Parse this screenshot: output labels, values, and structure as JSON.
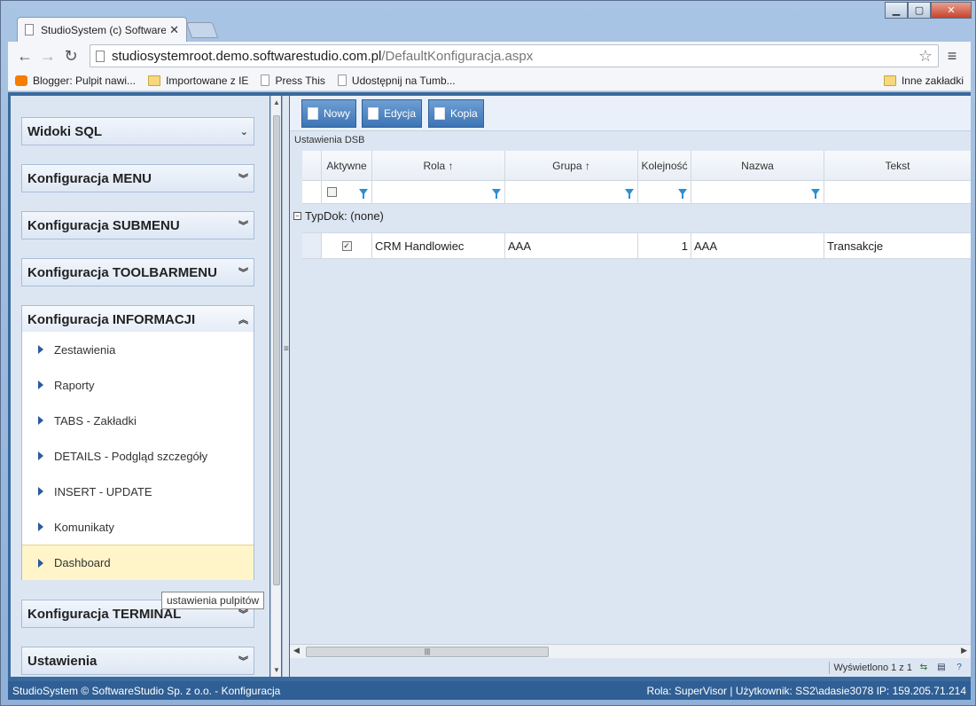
{
  "browser": {
    "tab_title": "StudioSystem (c) Software",
    "url_host": "studiosystemroot.demo.softwarestudio.com.pl",
    "url_path": "/DefaultKonfiguracja.aspx",
    "bookmarks": [
      "Blogger: Pulpit nawi...",
      "Importowane z IE",
      "Press This",
      "Udostępnij na Tumb..."
    ],
    "other_bookmarks": "Inne zakładki"
  },
  "sidebar": {
    "sections": [
      {
        "label": "Widoki SQL"
      },
      {
        "label": "Konfiguracja MENU"
      },
      {
        "label": "Konfiguracja SUBMENU"
      },
      {
        "label": "Konfiguracja TOOLBARMENU"
      },
      {
        "label": "Konfiguracja INFORMACJI"
      },
      {
        "label": "Konfiguracja TERMINAL"
      },
      {
        "label": "Ustawienia"
      }
    ],
    "items": [
      {
        "label": "Zestawienia"
      },
      {
        "label": "Raporty"
      },
      {
        "label": "TABS - Zakładki"
      },
      {
        "label": "DETAILS - Podgląd szczegóły"
      },
      {
        "label": "INSERT - UPDATE"
      },
      {
        "label": "Komunikaty"
      },
      {
        "label": "Dashboard"
      }
    ],
    "tooltip": "ustawienia pulpitów"
  },
  "toolbar": {
    "new_label": "Nowy",
    "edit_label": "Edycja",
    "copy_label": "Kopia"
  },
  "grid": {
    "caption": "Ustawienia DSB",
    "columns": [
      "Aktywne",
      "Rola ↑",
      "Grupa ↑",
      "Kolejność",
      "Nazwa",
      "Tekst"
    ],
    "group_label": "TypDok: (none)",
    "row": {
      "rola": "CRM Handlowiec",
      "grupa": "AAA",
      "kolejnosc": "1",
      "nazwa": "AAA",
      "tekst": "Transakcje"
    },
    "pager_text": "Wyświetlono 1 z 1"
  },
  "status": {
    "left": "StudioSystem © SoftwareStudio Sp. z o.o. - Konfiguracja",
    "right": "Rola: SuperVisor | Użytkownik: SS2\\adasie3078 IP: 159.205.71.214"
  }
}
